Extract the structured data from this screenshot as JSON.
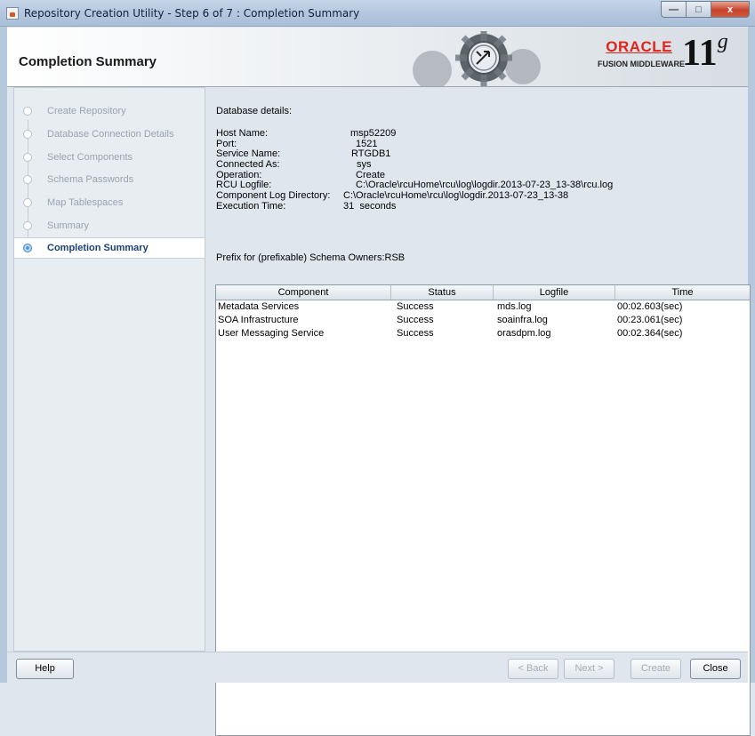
{
  "window": {
    "title": "Repository Creation Utility - Step 6 of 7 : Completion Summary",
    "minimize_glyph": "—",
    "maximize_glyph": "□",
    "close_glyph": "x"
  },
  "banner": {
    "page_title": "Completion Summary",
    "oracle_word": "ORACLE",
    "fusion_middleware": "FUSION MIDDLEWARE",
    "version_num": "11",
    "version_suffix": "g"
  },
  "steps": [
    {
      "label": "Create Repository",
      "state": "done"
    },
    {
      "label": "Database Connection Details",
      "state": "done"
    },
    {
      "label": "Select Components",
      "state": "done"
    },
    {
      "label": "Schema Passwords",
      "state": "done"
    },
    {
      "label": "Map Tablespaces",
      "state": "done"
    },
    {
      "label": "Summary",
      "state": "done"
    },
    {
      "label": "Completion Summary",
      "state": "current"
    }
  ],
  "details": {
    "heading": "Database details:",
    "rows": [
      {
        "key": "Host Name:",
        "value": "msp52209"
      },
      {
        "key": "Port:",
        "value": "1521"
      },
      {
        "key": "Service Name:",
        "value": "RTGDB1"
      },
      {
        "key": "Connected As:",
        "value": "sys"
      },
      {
        "key": "Operation:",
        "value": "Create"
      },
      {
        "key": "RCU Logfile:",
        "value": "C:\\Oracle\\rcuHome\\rcu\\log\\logdir.2013-07-23_13-38\\rcu.log"
      },
      {
        "key": "Component Log Directory:",
        "value": "C:\\Oracle\\rcuHome\\rcu\\log\\logdir.2013-07-23_13-38"
      },
      {
        "key": "Execution Time:",
        "value": "31  seconds"
      }
    ],
    "prefix": "Prefix for (prefixable) Schema Owners:RSB"
  },
  "table": {
    "columns": [
      "Component",
      "Status",
      "Logfile",
      "Time"
    ],
    "rows": [
      [
        "Metadata Services",
        "Success",
        "mds.log",
        "00:02.603(sec)"
      ],
      [
        "SOA Infrastructure",
        "Success",
        "soainfra.log",
        "00:23.061(sec)"
      ],
      [
        "User Messaging Service",
        "Success",
        "orasdpm.log",
        "00:02.364(sec)"
      ]
    ]
  },
  "buttons": {
    "help": "Help",
    "back": "< Back",
    "next": "Next >",
    "create": "Create",
    "close": "Close"
  }
}
